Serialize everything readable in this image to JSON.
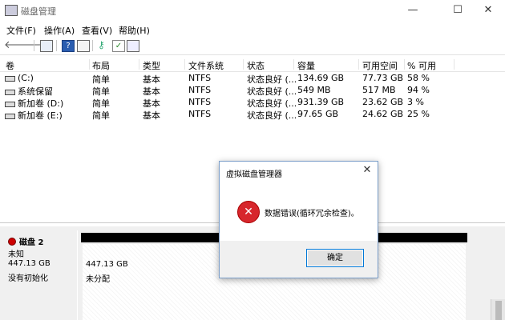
{
  "window": {
    "title": "磁盘管理",
    "minimize_glyph": "—",
    "maximize_glyph": "☐",
    "close_glyph": "✕"
  },
  "menu": [
    {
      "label": "文件(F)"
    },
    {
      "label": "操作(A)"
    },
    {
      "label": "查看(V)"
    },
    {
      "label": "帮助(H)"
    }
  ],
  "toolbar": {
    "back_glyph": "🡐",
    "forward_glyph": "🡒",
    "icons": [
      "back-icon",
      "forward-icon",
      "console-tree-icon",
      "help-icon",
      "properties-icon",
      "key-icon",
      "check-icon",
      "view-icon"
    ]
  },
  "volumes": {
    "headers": [
      "卷",
      "布局",
      "类型",
      "文件系统",
      "状态",
      "容量",
      "可用空间",
      "% 可用"
    ],
    "rows": [
      {
        "name": "(C:)",
        "layout": "简单",
        "type": "基本",
        "fs": "NTFS",
        "status": "状态良好 (...",
        "capacity": "134.69 GB",
        "free": "77.73 GB",
        "pct": "58 %"
      },
      {
        "name": "系统保留",
        "layout": "简单",
        "type": "基本",
        "fs": "NTFS",
        "status": "状态良好 (...",
        "capacity": "549 MB",
        "free": "517 MB",
        "pct": "94 %"
      },
      {
        "name": "新加卷 (D:)",
        "layout": "简单",
        "type": "基本",
        "fs": "NTFS",
        "status": "状态良好 (...",
        "capacity": "931.39 GB",
        "free": "23.62 GB",
        "pct": "3 %"
      },
      {
        "name": "新加卷 (E:)",
        "layout": "简单",
        "type": "基本",
        "fs": "NTFS",
        "status": "状态良好 (...",
        "capacity": "97.65 GB",
        "free": "24.62 GB",
        "pct": "25 %"
      }
    ]
  },
  "disk": {
    "name": "磁盘 2",
    "state": "未知",
    "size": "447.13 GB",
    "init": "没有初始化",
    "partition_size": "447.13 GB",
    "partition_state": "未分配"
  },
  "dialog": {
    "title": "虚拟磁盘管理器",
    "message": "数据错误(循环冗余检查)。",
    "ok_label": "确定",
    "close_glyph": "✕",
    "error_glyph": "✕"
  }
}
